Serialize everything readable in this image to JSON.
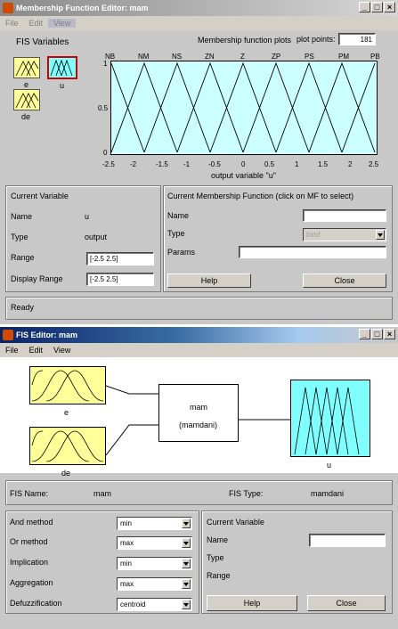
{
  "mf_editor": {
    "title": "Membership Function Editor: mam",
    "menu": [
      "File",
      "Edit",
      "View"
    ],
    "fis_vars_label": "FIS Variables",
    "vars": [
      {
        "name": "e",
        "selected": false
      },
      {
        "name": "u",
        "selected": true
      },
      {
        "name": "de",
        "selected": false
      }
    ],
    "plot_title": "Membership function plots",
    "plot_points_label": "plot points:",
    "plot_points_value": "181",
    "mf_names": [
      "NB",
      "NM",
      "NS",
      "ZN",
      "Z",
      "ZP",
      "PS",
      "PM",
      "PB"
    ],
    "y_ticks": [
      "1",
      "0.5",
      "0"
    ],
    "x_ticks": [
      "-2.5",
      "-2",
      "-1.5",
      "-1",
      "-0.5",
      "0",
      "0.5",
      "1",
      "1.5",
      "2",
      "2.5"
    ],
    "x_axis_label": "output variable \"u\"",
    "current_variable": {
      "heading": "Current Variable",
      "name_label": "Name",
      "name_value": "u",
      "type_label": "Type",
      "type_value": "output",
      "range_label": "Range",
      "range_value": "[-2.5 2.5]",
      "display_range_label": "Display Range",
      "display_range_value": "[-2.5 2.5]"
    },
    "current_mf": {
      "heading": "Current Membership Function (click on MF to select)",
      "name_label": "Name",
      "type_label": "Type",
      "type_value": "trimf",
      "params_label": "Params"
    },
    "help_label": "Help",
    "close_label": "Close",
    "status": "Ready",
    "colors": {
      "plot_bg": "#ccffff",
      "input_icon": "#ffff99",
      "output_icon": "#80ffff",
      "selected_border": "#cc0000"
    }
  },
  "fis_editor": {
    "title": "FIS Editor: mam",
    "menu": [
      "File",
      "Edit",
      "View"
    ],
    "input1": "e",
    "input2": "de",
    "system_name": "mam",
    "system_type": "(mamdani)",
    "output1": "u",
    "fis_name_label": "FIS Name:",
    "fis_name_value": "mam",
    "fis_type_label": "FIS Type:",
    "fis_type_value": "mamdani",
    "methods": [
      {
        "label": "And method",
        "value": "min"
      },
      {
        "label": "Or method",
        "value": "max"
      },
      {
        "label": "Implication",
        "value": "min"
      },
      {
        "label": "Aggregation",
        "value": "max"
      },
      {
        "label": "Defuzzification",
        "value": "centroid"
      }
    ],
    "current_variable": {
      "heading": "Current Variable",
      "name_label": "Name",
      "type_label": "Type",
      "range_label": "Range"
    },
    "help_label": "Help",
    "close_label": "Close"
  }
}
